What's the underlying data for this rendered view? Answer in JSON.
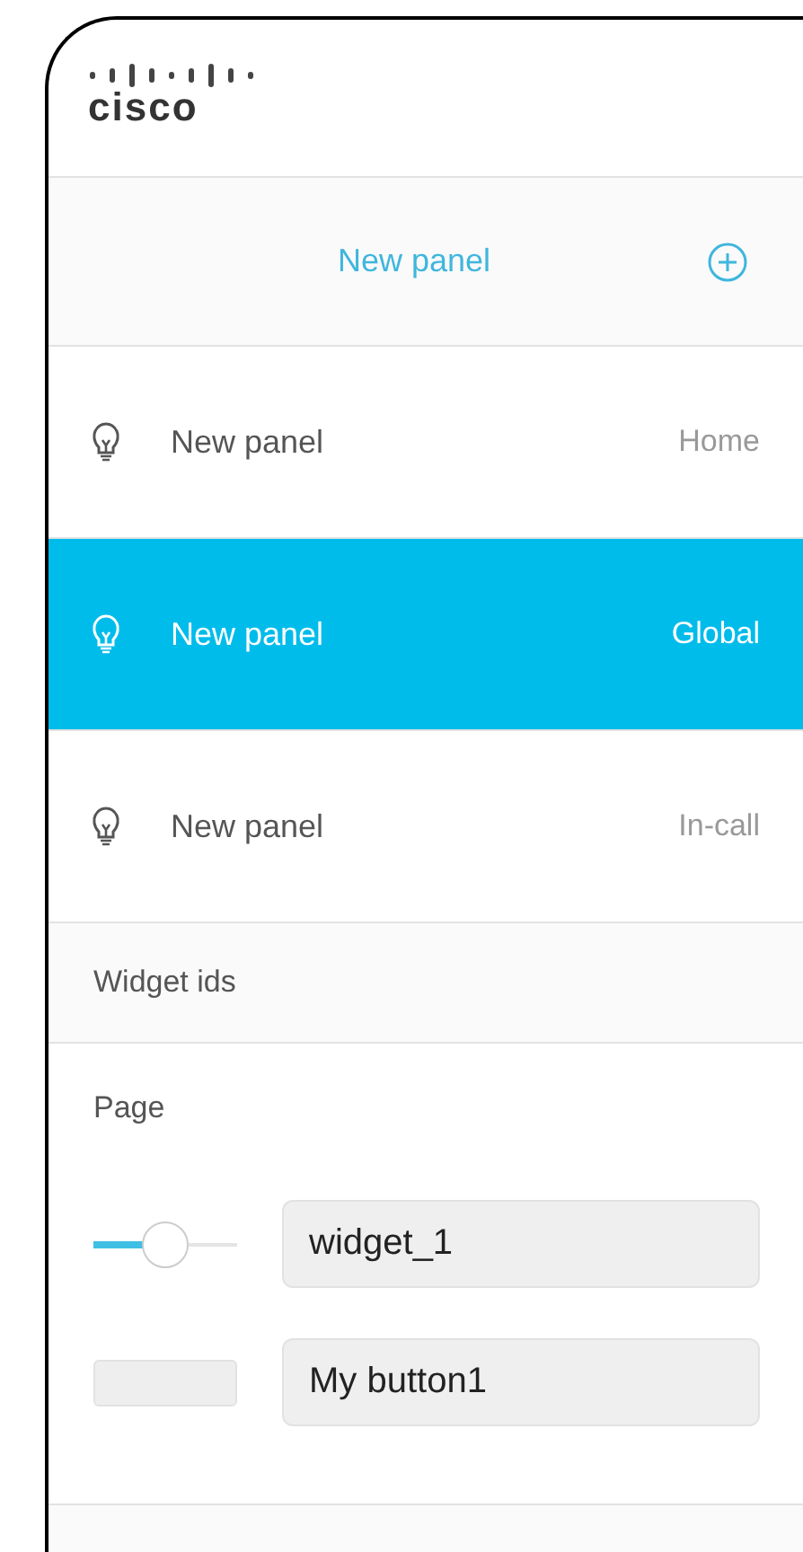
{
  "logo": {
    "text": "cisco"
  },
  "header": {
    "title": "New panel"
  },
  "panels": [
    {
      "name": "New panel",
      "location": "Home",
      "selected": false
    },
    {
      "name": "New panel",
      "location": "Global",
      "selected": true
    },
    {
      "name": "New panel",
      "location": "In-call",
      "selected": false
    }
  ],
  "widget_section": {
    "title": "Widget ids"
  },
  "page": {
    "title": "Page",
    "widgets": [
      {
        "kind": "slider",
        "level": 0.5,
        "id": "widget_1"
      },
      {
        "kind": "button",
        "id": "My button1"
      }
    ]
  }
}
